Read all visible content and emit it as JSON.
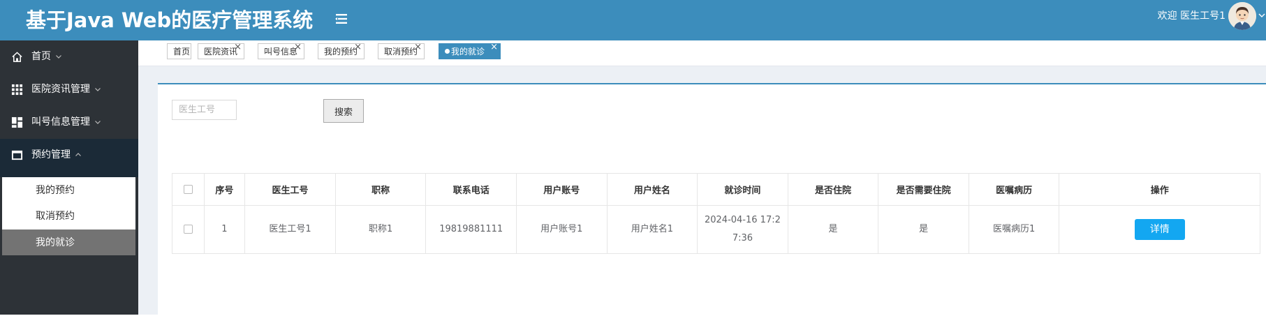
{
  "header": {
    "title": "基于Java Web的医疗管理系统",
    "welcome": "欢迎 医生工号1",
    "menu_toggle_icon": "menu-toggle-icon",
    "avatar_icon": "user-avatar",
    "colors": {
      "header_bg": "#3c8dbc",
      "sidebar_bg": "#2d3237",
      "active_nav_bg": "#1b2a37",
      "primary_button": "#13a7f1"
    }
  },
  "sidebar": {
    "items": [
      {
        "label": "首页",
        "icon": "home-icon"
      },
      {
        "label": "医院资讯管理",
        "icon": "grid-icon"
      },
      {
        "label": "叫号信息管理",
        "icon": "dashboard-icon"
      },
      {
        "label": "预约管理",
        "icon": "calendar-icon",
        "expanded": true
      }
    ],
    "submenu": [
      {
        "label": "我的预约"
      },
      {
        "label": "取消预约"
      },
      {
        "label": "我的就诊",
        "active": true
      }
    ]
  },
  "tabs": [
    {
      "label": "首页",
      "closable": false
    },
    {
      "label": "医院资讯",
      "closable": true
    },
    {
      "label": "叫号信息",
      "closable": true
    },
    {
      "label": "我的预约",
      "closable": true
    },
    {
      "label": "取消预约",
      "closable": true
    },
    {
      "label": "我的就诊",
      "closable": true,
      "active": true
    }
  ],
  "tab_close_glyph": "×",
  "search": {
    "placeholder": "医生工号",
    "value": "",
    "button_label": "搜索"
  },
  "table": {
    "headers": [
      "序号",
      "医生工号",
      "职称",
      "联系电话",
      "用户账号",
      "用户姓名",
      "就诊时间",
      "是否住院",
      "是否需要住院",
      "医嘱病历",
      "操作"
    ],
    "rows": [
      {
        "index": "1",
        "doctor_id": "医生工号1",
        "title": "职称1",
        "phone": "19819881111",
        "account": "用户账号1",
        "name": "用户姓名1",
        "visit_time": "2024-04-16 17:27:36",
        "hospitalized": "是",
        "needs_hospitalization": "是",
        "medical_record": "医嘱病历1",
        "action_label": "详情"
      }
    ]
  }
}
